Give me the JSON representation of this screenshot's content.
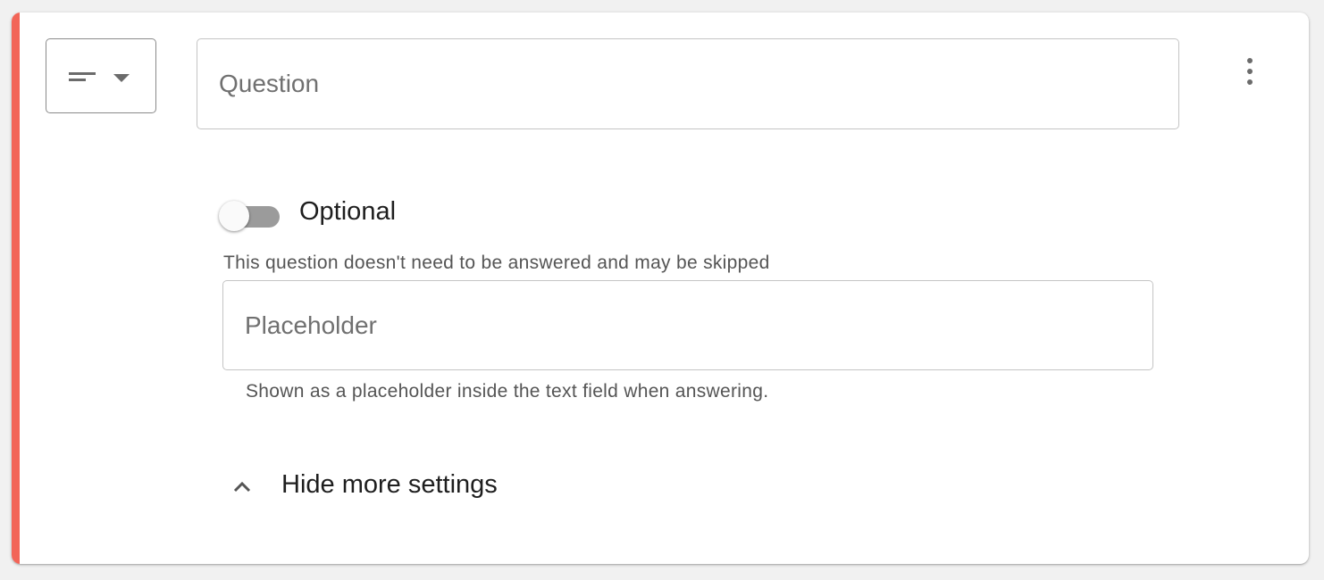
{
  "question_type": {
    "icon": "short-text-icon"
  },
  "question": {
    "placeholder": "Question",
    "value": ""
  },
  "menu": {
    "icon": "more-vert-icon"
  },
  "optional": {
    "label": "Optional",
    "enabled": false,
    "help": "This question doesn't need to be answered and may be skipped"
  },
  "placeholder_setting": {
    "placeholder": "Placeholder",
    "value": "",
    "help": "Shown as a placeholder inside the text field when answering."
  },
  "settings_toggle": {
    "label": "Hide more settings",
    "icon": "chevron-up-icon"
  },
  "colors": {
    "accent": "#f26558",
    "toggle_track": "#9b9b9b"
  }
}
